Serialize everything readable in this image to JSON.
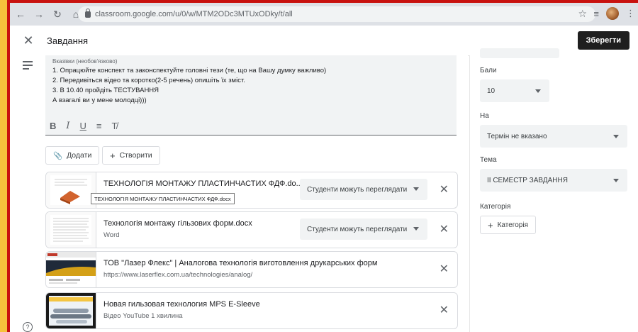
{
  "browser": {
    "url": "classroom.google.com/u/0/w/MTM2ODc3MTUxODky/t/all"
  },
  "header": {
    "title": "Завдання",
    "save_label": "Зберегти"
  },
  "instructions": {
    "label": "Вказівки (необов'язково)",
    "lines": [
      "1. Опрацюйте конспект та законспектуйте головні тези (те, що на Вашу думку важливо)",
      "2. Передивіться відео та коротко(2-5 речень) опишіть їх зміст.",
      "3. В 10.40 пройдіть ТЕСТУВАННЯ",
      "А взагалі ви у мене молодці)))"
    ]
  },
  "actions": {
    "add_label": "Додати",
    "create_label": "Створити"
  },
  "attachments": [
    {
      "title": "ТЕХНОЛОГІЯ МОНТАЖУ ПЛАСТИНЧАСТИХ ФДФ.do...",
      "subtitle": "",
      "permission": "Студенти можуть переглядати"
    },
    {
      "title": "Технологія монтажу гільзових форм.docx",
      "subtitle": "Word",
      "permission": "Студенти можуть переглядати"
    },
    {
      "title": "ТОВ \"Лазер Флекс\" | Аналогова технологія виготовлення друкарських форм",
      "subtitle": "https://www.laserflex.com.ua/technologies/analog/"
    },
    {
      "title": "Новая гильзовая технология MPS E-Sleeve",
      "subtitle": "Відео YouTube   1 хвилина"
    }
  ],
  "tooltip": "ТЕХНОЛОГІЯ МОНТАЖУ ПЛАСТИНЧАСТИХ ФДФ.docx",
  "settings": {
    "points_label": "Бали",
    "points_value": "10",
    "due_label": "На",
    "due_value": "Термін не вказано",
    "topic_label": "Тема",
    "topic_value": "II СЕМЕСТР ЗАВДАННЯ",
    "category_label": "Категорія",
    "category_button": "Категорія"
  }
}
